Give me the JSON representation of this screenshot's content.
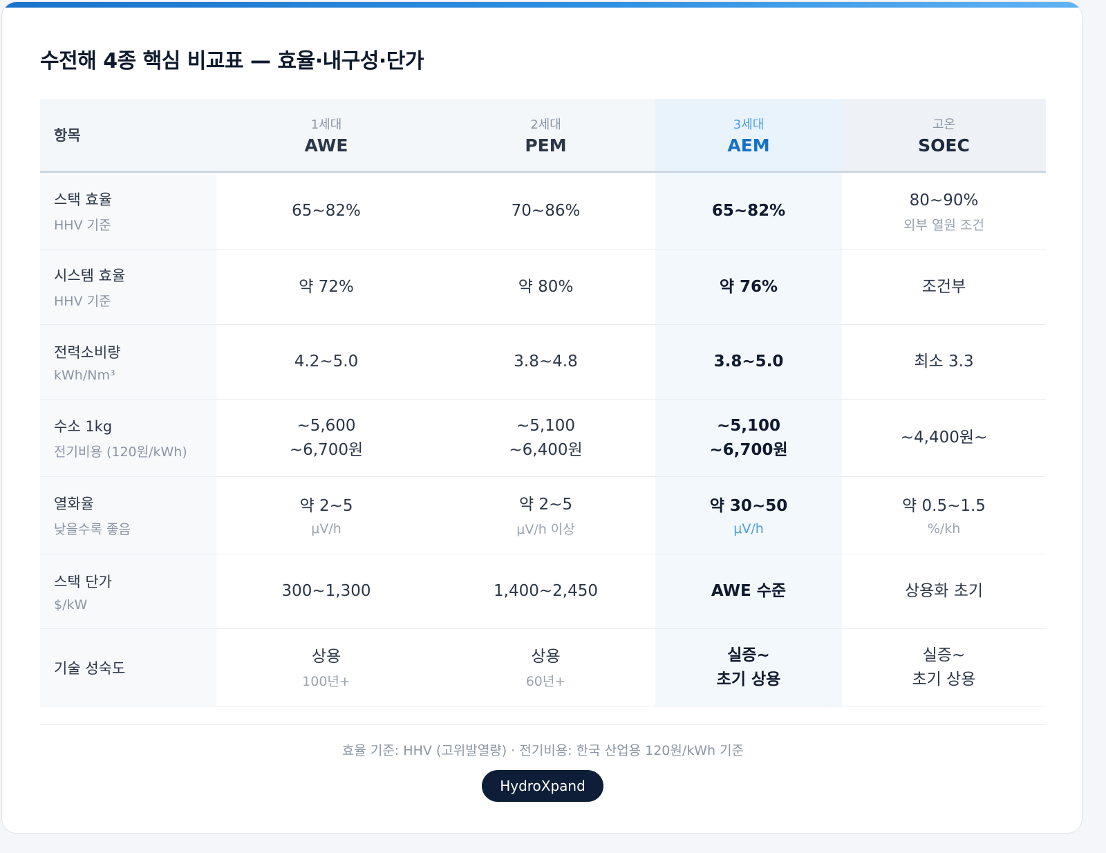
{
  "title": "수전해 4종 핵심 비교표 — 효율·내구성·단가",
  "header": {
    "item_label": "항목",
    "columns": [
      {
        "gen": "1세대",
        "tech": "AWE"
      },
      {
        "gen": "2세대",
        "tech": "PEM"
      },
      {
        "gen": "3세대",
        "tech": "AEM"
      },
      {
        "gen": "고온",
        "tech": "SOEC"
      }
    ]
  },
  "rows": [
    {
      "label": "스택 효율",
      "sub": "HHV 기준",
      "cells": [
        {
          "v1": "65~82%"
        },
        {
          "v1": "70~86%"
        },
        {
          "v1": "65~82%"
        },
        {
          "v1": "80~90%",
          "unit": "외부 열원 조건"
        }
      ]
    },
    {
      "label": "시스템 효율",
      "sub": "HHV 기준",
      "cells": [
        {
          "v1": "약 72%"
        },
        {
          "v1": "약 80%"
        },
        {
          "v1": "약 76%"
        },
        {
          "v1": "조건부"
        }
      ]
    },
    {
      "label": "전력소비량",
      "sub": "kWh/Nm³",
      "cells": [
        {
          "v1": "4.2~5.0"
        },
        {
          "v1": "3.8~4.8"
        },
        {
          "v1": "3.8~5.0"
        },
        {
          "v1": "최소 3.3"
        }
      ]
    },
    {
      "label": "수소 1kg",
      "sub": "전기비용 (120원/kWh)",
      "cells": [
        {
          "v1": "~5,600",
          "v2": "~6,700원"
        },
        {
          "v1": "~5,100",
          "v2": "~6,400원"
        },
        {
          "v1": "~5,100",
          "v2": "~6,700원"
        },
        {
          "v1": "~4,400원~"
        }
      ]
    },
    {
      "label": "열화율",
      "sub": "낮을수록 좋음",
      "cells": [
        {
          "v1": "약 2~5",
          "unit": "μV/h"
        },
        {
          "v1": "약 2~5",
          "unit": "μV/h 이상"
        },
        {
          "v1": "약 30~50",
          "unit": "μV/h"
        },
        {
          "v1": "약 0.5~1.5",
          "unit": "%/kh"
        }
      ]
    },
    {
      "label": "스택 단가",
      "sub": "$/kW",
      "cells": [
        {
          "v1": "300~1,300"
        },
        {
          "v1": "1,400~2,450"
        },
        {
          "v1": "AWE 수준"
        },
        {
          "v1": "상용화 초기"
        }
      ]
    },
    {
      "label": "기술 성숙도",
      "cells": [
        {
          "v1": "상용",
          "unit": "100년+"
        },
        {
          "v1": "상용",
          "unit": "60년+"
        },
        {
          "v1": "실증~",
          "v2": "초기 상용"
        },
        {
          "v1": "실증~",
          "v2": "초기 상용"
        }
      ]
    }
  ],
  "footnote": "효율 기준: HHV (고위발열량) · 전기비용: 한국 산업용 120원/kWh 기준",
  "brand": "HydroXpand",
  "colors": {
    "accent": "#1671c6",
    "highlight_bg": "#f3f8fd",
    "brand_bg": "#0f1e38"
  }
}
